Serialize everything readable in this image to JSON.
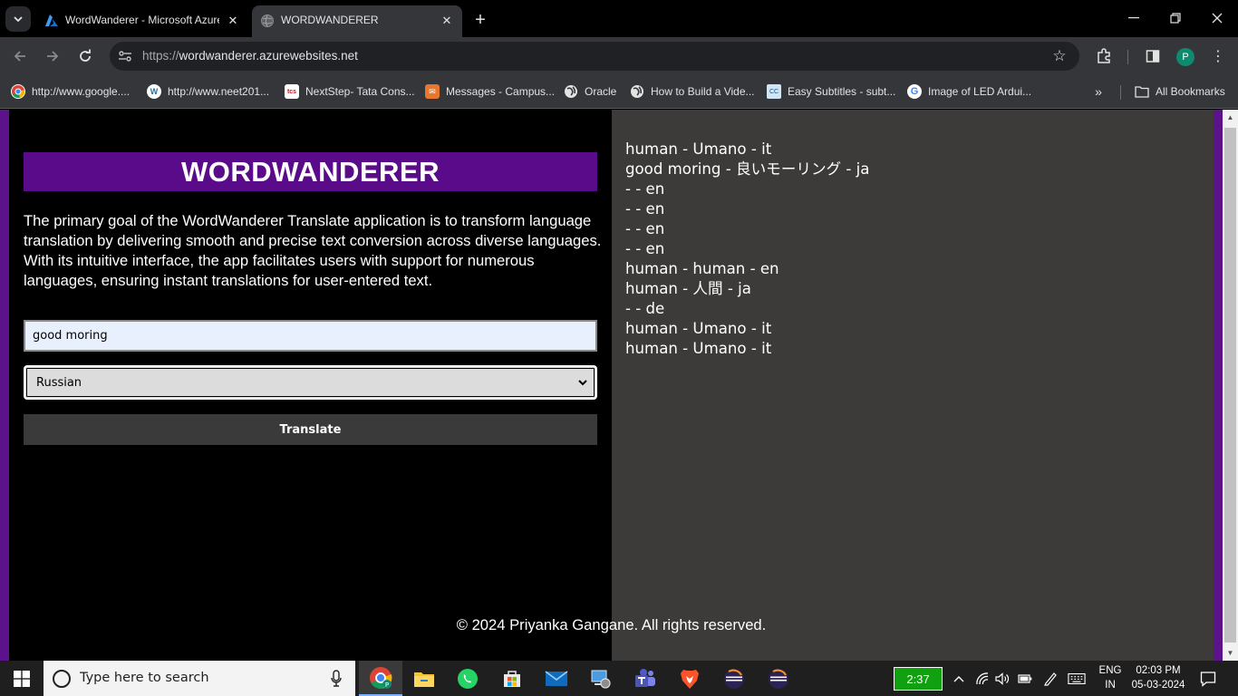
{
  "browser": {
    "tabs": [
      {
        "title": "WordWanderer - Microsoft Azure",
        "active": false
      },
      {
        "title": "WORDWANDERER",
        "active": true
      }
    ],
    "url_prefix": "https://",
    "url_host": "wordwanderer.azurewebsites.net",
    "avatar_letter": "P",
    "bookmarks": [
      {
        "label": "http://www.google...."
      },
      {
        "label": "http://www.neet201..."
      },
      {
        "label": "NextStep- Tata Cons..."
      },
      {
        "label": "Messages - Campus..."
      },
      {
        "label": "Oracle"
      },
      {
        "label": "How to Build a Vide..."
      },
      {
        "label": "Easy Subtitles - subt..."
      },
      {
        "label": "Image of LED Ardui..."
      }
    ],
    "all_bookmarks_label": "All Bookmarks"
  },
  "app": {
    "heading": "WORDWANDERER",
    "description": "The primary goal of the WordWanderer Translate application is to transform language translation by delivering smooth and precise text conversion across diverse languages. With its intuitive interface, the app facilitates users with support for numerous languages, ensuring instant translations for user-entered text.",
    "input_value": "good moring",
    "selected_language": "Russian",
    "translate_label": "Translate",
    "history": [
      "human - Umano - it",
      "good moring - 良いモーリング - ja",
      "- - en",
      "- - en",
      "- - en",
      "- - en",
      "human - human - en",
      "human - 人間 - ja",
      "- - de",
      "human - Umano - it",
      "human - Umano - it"
    ],
    "footer": "© 2024 Priyanka Gangane. All rights reserved.",
    "colors": {
      "accent": "#5a0b8a",
      "border_purple": "#5c128a",
      "right_pane": "#3c3b3a"
    }
  },
  "taskbar": {
    "search_placeholder": "Type here to search",
    "timer": "2:37",
    "lang_top": "ENG",
    "lang_bottom": "IN",
    "time": "02:03 PM",
    "date": "05-03-2024",
    "apps": [
      "chrome-icon",
      "file-explorer-icon",
      "whatsapp-icon",
      "store-icon",
      "mail-icon",
      "control-panel-icon",
      "teams-icon",
      "brave-icon",
      "eclipse-icon",
      "eclipse-icon"
    ]
  }
}
